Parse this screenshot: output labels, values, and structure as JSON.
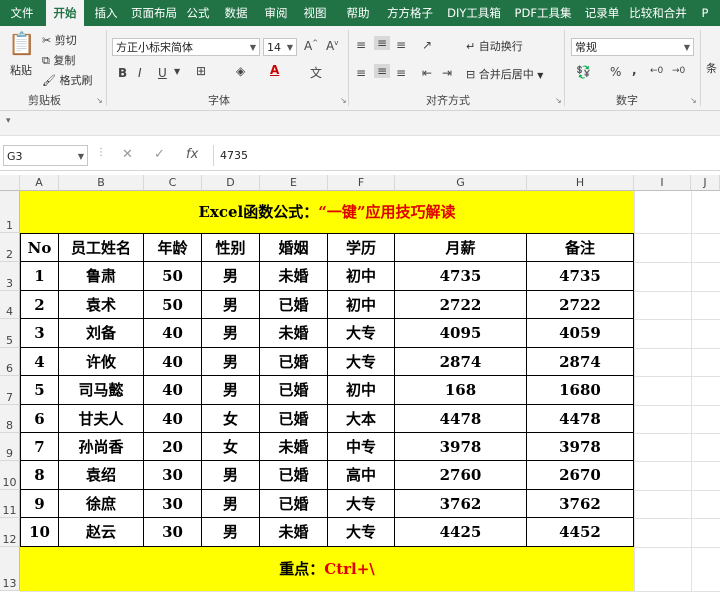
{
  "ribbon_tabs": [
    "文件",
    "开始",
    "插入",
    "页面布局",
    "公式",
    "数据",
    "审阅",
    "视图",
    "帮助",
    "方方格子",
    "DIY工具箱",
    "PDF工具集",
    "记录单",
    "比较和合并",
    "P"
  ],
  "active_tab_index": 1,
  "clipboard": {
    "paste": "粘贴",
    "cut": "剪切",
    "copy": "复制",
    "format_painter": "格式刷",
    "group": "剪贴板"
  },
  "font": {
    "name": "方正小标宋简体",
    "size": "14",
    "group": "字体",
    "bold": "B",
    "italic": "I",
    "underline": "U"
  },
  "alignment": {
    "wrap": "自动换行",
    "merge": "合并后居中",
    "group": "对齐方式"
  },
  "number": {
    "format": "常规",
    "group": "数字",
    "percent": "%",
    "comma": ","
  },
  "side_label": "条",
  "formula_bar": {
    "name_box": "G3",
    "fx": "fx",
    "value": "4735"
  },
  "columns": [
    "A",
    "B",
    "C",
    "D",
    "E",
    "F",
    "G",
    "H",
    "I",
    "J"
  ],
  "rows": [
    "1",
    "2",
    "3",
    "4",
    "5",
    "6",
    "7",
    "8",
    "9",
    "10",
    "11",
    "12",
    "13"
  ],
  "title": {
    "black": "Excel函数公式：",
    "red": "“一键”应用技巧解读"
  },
  "headers": [
    "No",
    "员工姓名",
    "年龄",
    "性别",
    "婚姻",
    "学历",
    "月薪",
    "备注"
  ],
  "table": [
    [
      "1",
      "鲁肃",
      "50",
      "男",
      "未婚",
      "初中",
      "4735",
      "4735"
    ],
    [
      "2",
      "袁术",
      "50",
      "男",
      "已婚",
      "初中",
      "2722",
      "2722"
    ],
    [
      "3",
      "刘备",
      "40",
      "男",
      "未婚",
      "大专",
      "4095",
      "4059"
    ],
    [
      "4",
      "许攸",
      "40",
      "男",
      "已婚",
      "大专",
      "2874",
      "2874"
    ],
    [
      "5",
      "司马懿",
      "40",
      "男",
      "已婚",
      "初中",
      "168",
      "1680"
    ],
    [
      "6",
      "甘夫人",
      "40",
      "女",
      "已婚",
      "大本",
      "4478",
      "4478"
    ],
    [
      "7",
      "孙尚香",
      "20",
      "女",
      "未婚",
      "中专",
      "3978",
      "3978"
    ],
    [
      "8",
      "袁绍",
      "30",
      "男",
      "已婚",
      "高中",
      "2760",
      "2670"
    ],
    [
      "9",
      "徐庶",
      "30",
      "男",
      "已婚",
      "大专",
      "3762",
      "3762"
    ],
    [
      "10",
      "赵云",
      "30",
      "男",
      "未婚",
      "大专",
      "4425",
      "4452"
    ]
  ],
  "footer": {
    "black": "重点：",
    "red": "Ctrl+\\"
  },
  "colors": {
    "ribbon": "#217346",
    "highlight": "#ffff00",
    "accent_red": "#e00000"
  }
}
